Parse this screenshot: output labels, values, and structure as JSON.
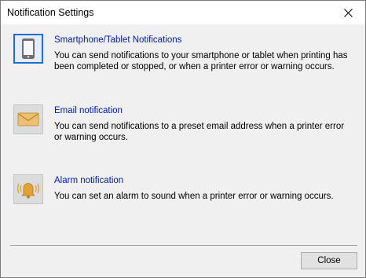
{
  "window": {
    "title": "Notification Settings",
    "close_icon": "close-x-icon"
  },
  "options": [
    {
      "icon": "smartphone-icon",
      "title": "Smartphone/Tablet Notifications",
      "description": "You can send notifications to your smartphone or tablet when printing has been completed or stopped, or when a printer error or warning occurs.",
      "selected": true
    },
    {
      "icon": "envelope-icon",
      "title": "Email notification",
      "description": "You can send notifications to a preset email address when a printer error or warning occurs.",
      "selected": false
    },
    {
      "icon": "alarm-bell-icon",
      "title": "Alarm notification",
      "description": "You can set an alarm to sound when a printer error or warning occurs.",
      "selected": false
    }
  ],
  "footer": {
    "close_label": "Close"
  },
  "colors": {
    "link": "#0019b0",
    "selection_border": "#1a6fd1",
    "envelope": "#e8b95c",
    "bell": "#e0a030"
  }
}
